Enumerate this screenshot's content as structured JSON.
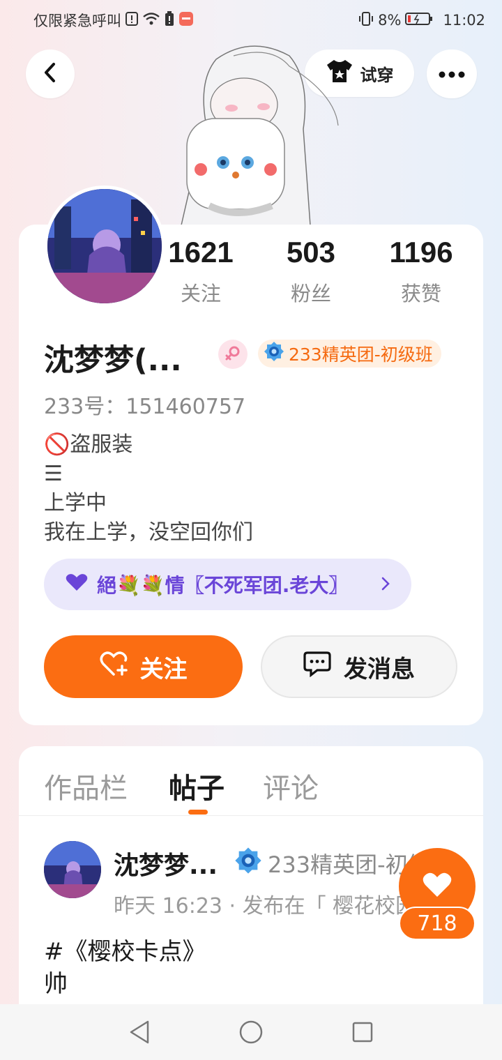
{
  "status_bar": {
    "carrier_text": "仅限紧急呼叫",
    "battery_percent": "8%",
    "time": "11:02",
    "icons": [
      "alert-icon",
      "wifi-icon",
      "battery-warning-icon",
      "app-notify-icon",
      "vibrate-icon",
      "battery-icon"
    ]
  },
  "header": {
    "try_on_label": "试穿",
    "icons": [
      "back-arrow-icon",
      "shirt-icon",
      "more-dots-icon"
    ]
  },
  "profile": {
    "stats": [
      {
        "value": "1621",
        "label": "关注"
      },
      {
        "value": "503",
        "label": "粉丝"
      },
      {
        "value": "1196",
        "label": "获赞"
      }
    ],
    "name": "沈梦梦(...",
    "gender_icon": "female-icon",
    "elite_badge": "233精英团-初级班",
    "uid": "233号：151460757",
    "bio": [
      "🚫盗服装",
      "☰",
      "上学中",
      "我在上学，没空回你们"
    ],
    "guild": "絕💐💐情〖不死军团.老大〗",
    "follow_label": "关注",
    "message_label": "发消息"
  },
  "tabs": [
    {
      "label": "作品栏",
      "active": false
    },
    {
      "label": "帖子",
      "active": true
    },
    {
      "label": "评论",
      "active": false
    }
  ],
  "post": {
    "author": "沈梦梦...",
    "badge": "233精英团-初级班",
    "meta": "昨天 16:23 · 发布在「 樱花校园模拟器",
    "lines": [
      "#《樱校卡点》",
      "帅"
    ],
    "like_count": "718"
  },
  "colors": {
    "accent": "#fb6d12",
    "guild_bg": "#eae8fb",
    "guild_text": "#6a45d8"
  }
}
